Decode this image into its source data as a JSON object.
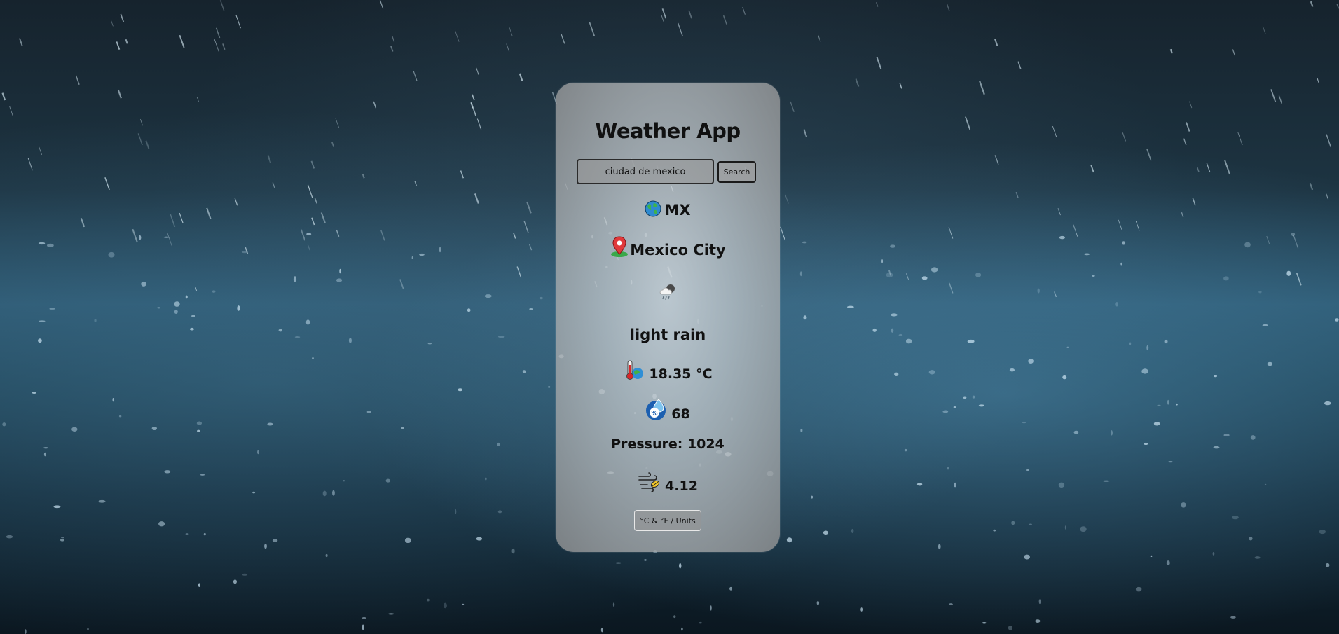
{
  "app": {
    "title": "Weather App"
  },
  "search": {
    "value": "ciudad de mexico",
    "button_label": "Search"
  },
  "weather": {
    "country": "MX",
    "country_icon": "globe-icon",
    "city": "Mexico City",
    "city_icon": "map-pin-icon",
    "condition_icon": "rain-cloud-icon",
    "description": "light rain",
    "temperature": "18.35 °C",
    "temperature_icon": "thermometer-icon",
    "humidity": "68",
    "humidity_icon": "humidity-drop-icon",
    "pressure": "Pressure: 1024",
    "wind": "4.12",
    "wind_icon": "wind-icon"
  },
  "units_button": {
    "label": "°C & °F / Units"
  },
  "colors": {
    "card": "#b9bec2",
    "text": "#111111",
    "background": "#1d3a4a"
  }
}
